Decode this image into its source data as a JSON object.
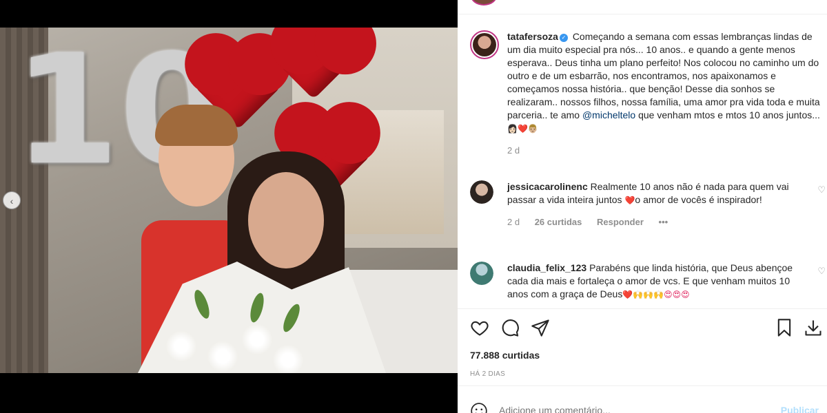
{
  "post": {
    "author": "tatafersoza",
    "verified": true,
    "caption": "Começando a semana com essas lembranças lindas de um dia muito especial pra nós... 10 anos.. e quando a gente menos esperava.. Deus tinha um plano perfeito! Nos colocou no caminho um do outro e de um esbarrão, nos encontramos, nos apaixonamos e começamos nossa história.. que benção! Desse dia sonhos se realizaram.. nossos filhos, nossa família, uma amor pra vida toda e muita parceria.. te amo",
    "mention": "@micheltelo",
    "caption_end": "que venham mtos e mtos 10 anos juntos...",
    "caption_emoji": "👩🏻❤️👨🏼",
    "time": "2 d"
  },
  "media": {
    "nav_prev": "‹",
    "balloon_text": "10"
  },
  "comments": [
    {
      "user": "jessicacarolinenc",
      "text": "Realmente 10 anos não é nada para quem vai passar a vida inteira juntos",
      "emoji": "❤️",
      "text_after": "o amor de vocês é inspirador!",
      "time": "2 d",
      "likes": "26 curtidas",
      "reply": "Responder",
      "more": "•••"
    },
    {
      "user": "claudia_felix_123",
      "text": "Parabéns que linda história, que Deus abençoe cada dia mais e fortaleça o amor de vcs. E que venham muitos 10 anos com a graça de Deus",
      "emoji": "❤️🙌🙌🙌😍😍😍"
    }
  ],
  "actions": {
    "like_icon": "heart-icon",
    "comment_icon": "comment-icon",
    "share_icon": "share-icon",
    "save_icon": "bookmark-icon",
    "download_icon": "download-icon"
  },
  "likes_count": "77.888 curtidas",
  "posted_ago": "HÁ 2 DIAS",
  "comment_box": {
    "placeholder": "Adicione um comentário...",
    "publish": "Publicar"
  },
  "colors": {
    "accent": "#c13584",
    "link": "#00376b",
    "publish_disabled": "#b2dffc",
    "verified": "#3897f0"
  }
}
